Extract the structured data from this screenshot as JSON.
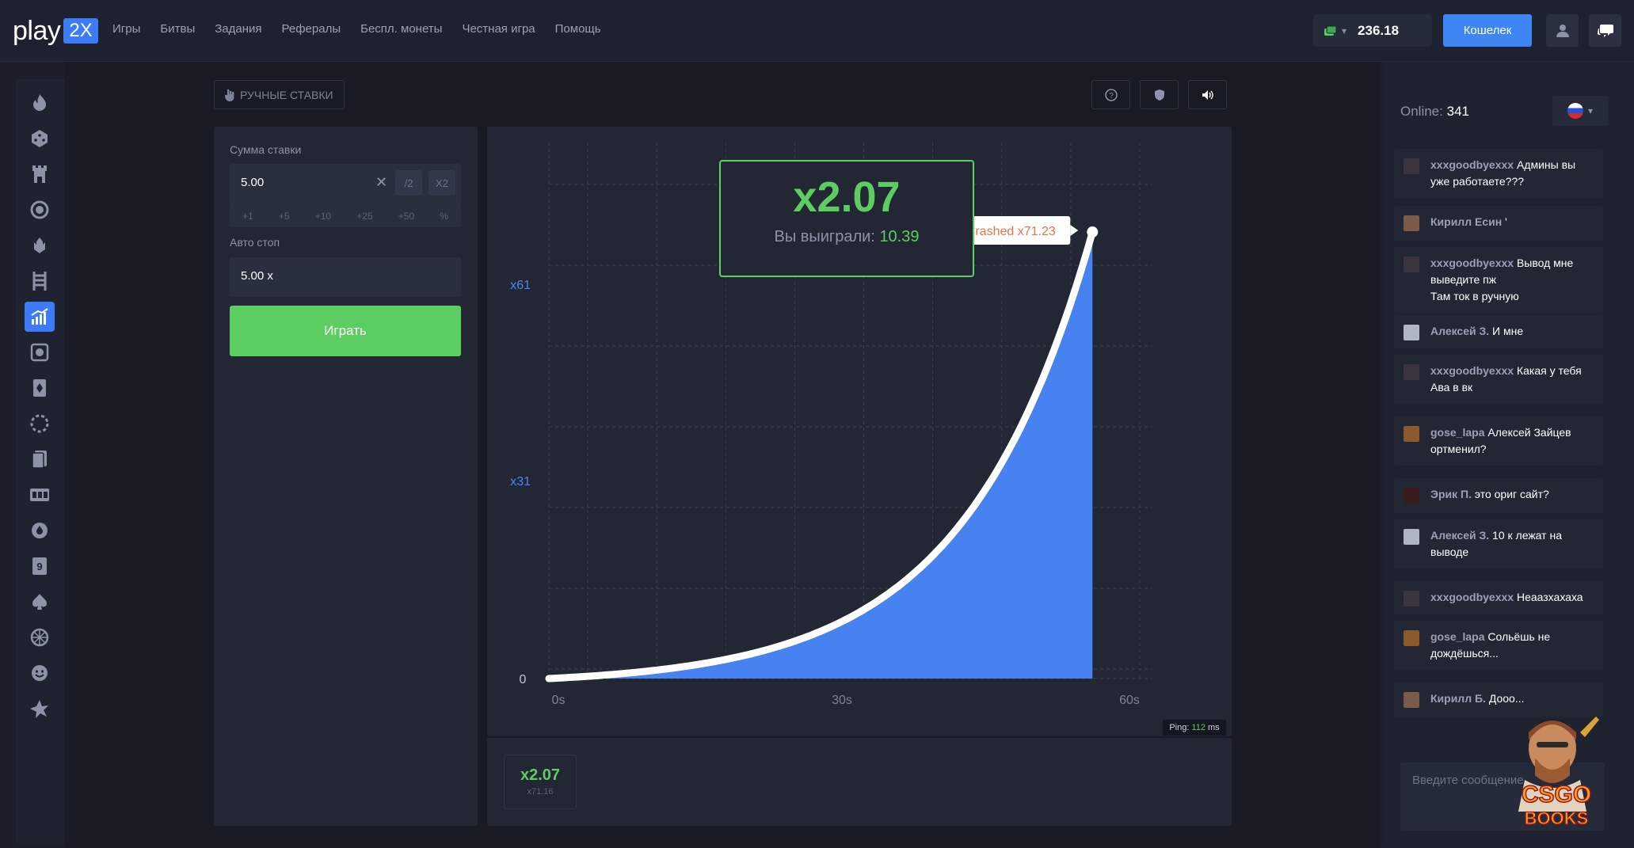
{
  "header": {
    "logo_text": "play",
    "logo_badge": "2X",
    "nav": [
      "Игры",
      "Битвы",
      "Задания",
      "Рефералы",
      "Беспл. монеты",
      "Честная игра",
      "Помощь"
    ],
    "balance": "236.18",
    "wallet_label": "Кошелек"
  },
  "controls": {
    "manual_label": "РУЧНЫЕ СТАВКИ"
  },
  "bet": {
    "amount_label": "Сумма ставки",
    "amount_value": "5.00",
    "half_label": "/2",
    "double_label": "X2",
    "quick": [
      "+1",
      "+5",
      "+10",
      "+25",
      "+50",
      "%"
    ],
    "autostop_label": "Авто стоп",
    "autostop_value": "5.00 x",
    "play_label": "Играть"
  },
  "game": {
    "multiplier": "x2.07",
    "win_label": "Вы выиграли:",
    "win_value": "10.39",
    "crashed_label": "Crashed x71.23",
    "ping_label": "Ping:",
    "ping_value": "112",
    "ping_unit": "ms"
  },
  "chart_data": {
    "type": "area",
    "x_ticks": [
      "0s",
      "30s",
      "60s"
    ],
    "y_ticks": [
      "0",
      "x31",
      "x61"
    ],
    "x_range": [
      0,
      65
    ],
    "y_range": [
      0,
      71.23
    ],
    "end_point": {
      "x": 64,
      "y": 71.23
    },
    "curve": "exponential",
    "fill_color": "#4683f0",
    "line_color": "#ffffff"
  },
  "history": [
    {
      "multiplier": "x2.07",
      "sub": "x71.16"
    }
  ],
  "chat": {
    "online_label": "Online:",
    "online_count": "341",
    "messages": [
      {
        "user": "xxxgoodbyexxx",
        "text": "Админы вы уже работаете???"
      },
      {
        "user": "Кирилл Есин",
        "text": "'"
      },
      {
        "user": "xxxgoodbyexxx",
        "text": "Вывод мне выведите пж",
        "text2": "Там ток в ручную"
      },
      {
        "user": "Алексей З.",
        "text": "И мне"
      },
      {
        "user": "xxxgoodbyexxx",
        "text": "Какая у тебя Ава в вк"
      },
      {
        "user": "gose_lapa",
        "text": "Алексей Зайцев ортменил?"
      },
      {
        "user": "Эрик П.",
        "text": "это ориг сайт?"
      },
      {
        "user": "Алексей З.",
        "text": "10 к лежат на выводе"
      },
      {
        "user": "xxxgoodbyexxx",
        "text": "Неаазхахаха"
      },
      {
        "user": "gose_lapa",
        "text": "Сольёшь не дождёшься..."
      },
      {
        "user": "Кирилл Б.",
        "text": "Дооо..."
      }
    ],
    "input_placeholder": "Введите сообщение"
  },
  "watermark": {
    "text": "CSGO BOOKS"
  },
  "colors": {
    "accent": "#3d7bfa",
    "green": "#5ccd60",
    "crash": "#e8734a"
  }
}
